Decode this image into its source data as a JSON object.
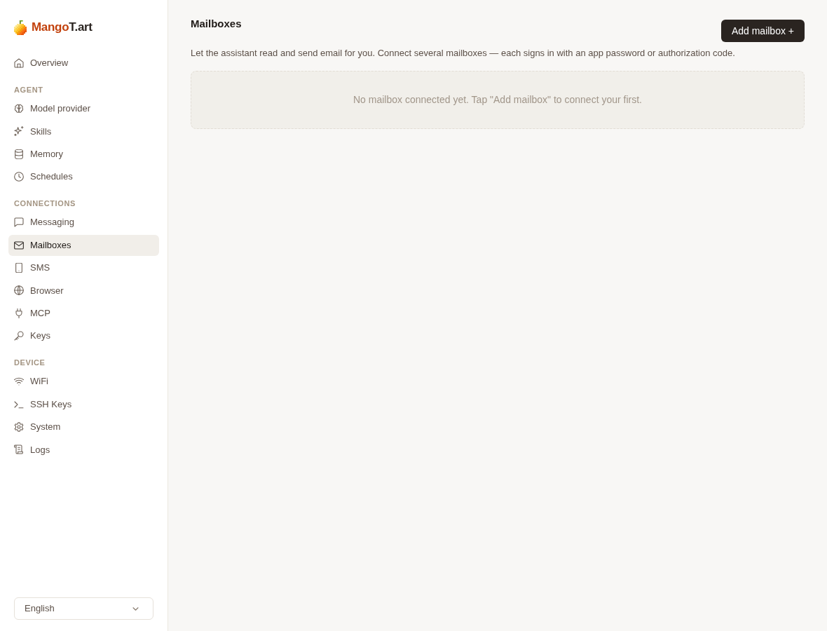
{
  "brand": {
    "accent": "Mango",
    "rest": "T.art"
  },
  "sidebar": {
    "sections": [
      {
        "items": [
          {
            "label": "Overview",
            "selected": false
          }
        ]
      },
      {
        "heading": "AGENT",
        "items": [
          {
            "label": "Model provider",
            "selected": false
          },
          {
            "label": "Skills",
            "selected": false
          },
          {
            "label": "Memory",
            "selected": false
          },
          {
            "label": "Schedules",
            "selected": false
          }
        ]
      },
      {
        "heading": "CONNECTIONS",
        "items": [
          {
            "label": "Messaging",
            "selected": false
          },
          {
            "label": "Mailboxes",
            "selected": true
          },
          {
            "label": "SMS",
            "selected": false
          },
          {
            "label": "Browser",
            "selected": false
          },
          {
            "label": "MCP",
            "selected": false
          },
          {
            "label": "Keys",
            "selected": false
          }
        ]
      },
      {
        "heading": "DEVICE",
        "items": [
          {
            "label": "WiFi",
            "selected": false
          },
          {
            "label": "SSH Keys",
            "selected": false
          },
          {
            "label": "System",
            "selected": false
          },
          {
            "label": "Logs",
            "selected": false
          }
        ]
      }
    ]
  },
  "language_select": {
    "value": "English"
  },
  "page": {
    "title": "Mailboxes",
    "add_button": "Add mailbox +",
    "description": "Let the assistant read and send email for you. Connect several mailboxes — each signs in with an app password or authorization code.",
    "empty_state": "No mailbox connected yet. Tap \"Add mailbox\" to connect your first."
  }
}
